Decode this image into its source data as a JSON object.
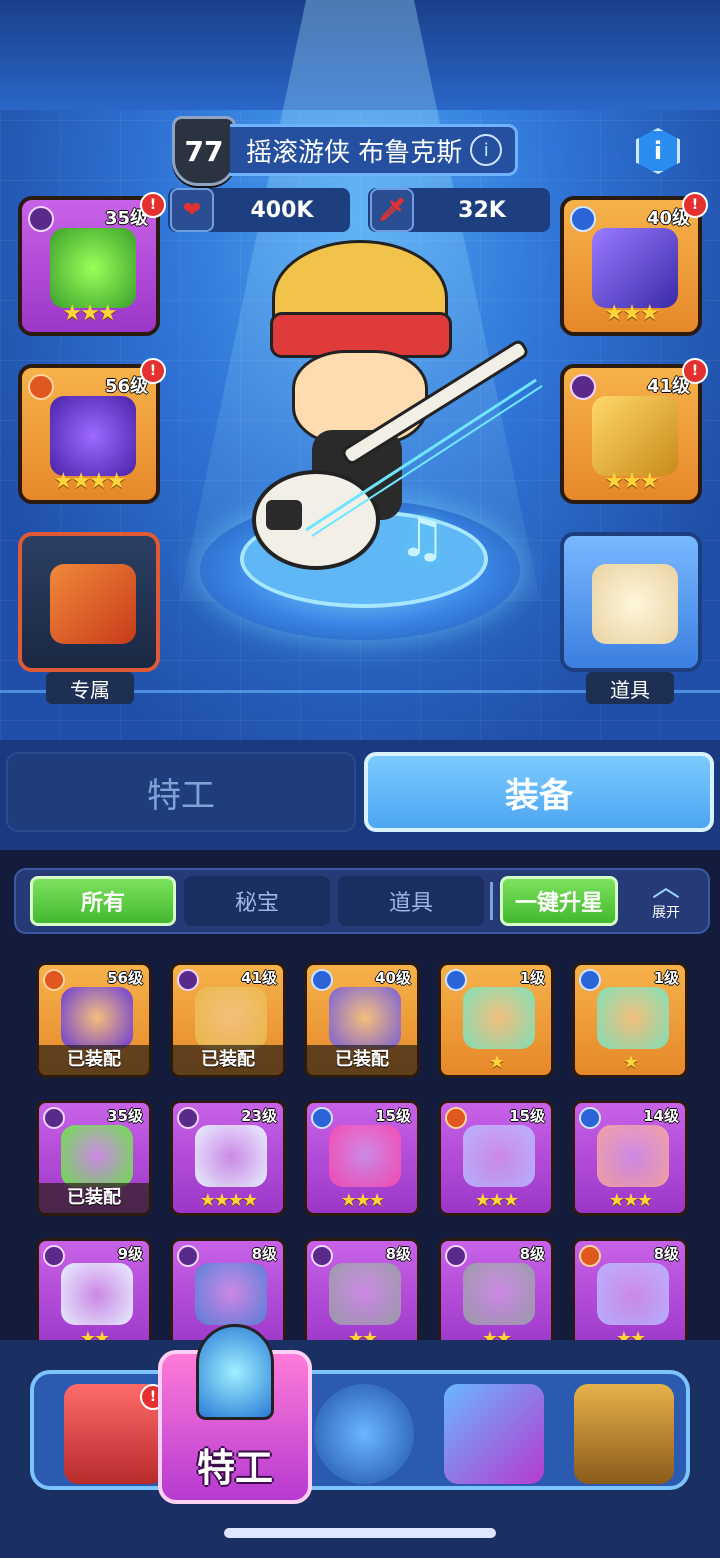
{
  "header": {
    "level": "77",
    "hero_name": "摇滚游侠 布鲁克斯",
    "info_glyph": "i",
    "corner_info_glyph": "i"
  },
  "stats": {
    "hp": "400K",
    "atk": "32K",
    "hp_icon": "heart-icon",
    "atk_icon": "sword-icon"
  },
  "left_slots": [
    {
      "level": "35级",
      "rarity": "gem",
      "stars": "★★★",
      "alert": "!"
    },
    {
      "level": "56级",
      "rarity": "crown",
      "stars": "★★★★",
      "alert": "!"
    },
    {
      "label": "专属"
    }
  ],
  "right_slots": [
    {
      "level": "40级",
      "rarity": "shield",
      "stars": "★★★",
      "alert": "!"
    },
    {
      "level": "41级",
      "rarity": "gem",
      "stars": "★★★",
      "alert": "!"
    },
    {
      "label": "道具"
    }
  ],
  "main_tabs": {
    "agent": "特工",
    "equip": "装备"
  },
  "filters": {
    "all": "所有",
    "treasure": "秘宝",
    "items": "道具",
    "upgrade_all": "一键升星",
    "expand": "展开"
  },
  "inventory": [
    {
      "level": "56级",
      "color": "orange",
      "rarity": "crown",
      "stars": "",
      "equipped": "已装配",
      "art": "#6b3ad6"
    },
    {
      "level": "41级",
      "color": "orange",
      "rarity": "gem",
      "stars": "",
      "equipped": "已装配",
      "art": "#e9b84a"
    },
    {
      "level": "40级",
      "color": "orange",
      "rarity": "shield",
      "stars": "",
      "equipped": "已装配",
      "art": "#7a5fd6"
    },
    {
      "level": "1级",
      "color": "orange",
      "rarity": "shield",
      "stars": "★",
      "equipped": "",
      "art": "#7ee0b8"
    },
    {
      "level": "1级",
      "color": "orange",
      "rarity": "shield",
      "stars": "★",
      "equipped": "",
      "art": "#7ee0b8"
    },
    {
      "level": "35级",
      "color": "purple",
      "rarity": "gem",
      "stars": "",
      "equipped": "已装配",
      "art": "#6be04a"
    },
    {
      "level": "23级",
      "color": "purple",
      "rarity": "gem",
      "stars": "★★★★",
      "equipped": "",
      "art": "#e6f0ff"
    },
    {
      "level": "15级",
      "color": "purple",
      "rarity": "shield",
      "stars": "★★★",
      "equipped": "",
      "art": "#f24ab0"
    },
    {
      "level": "15级",
      "color": "purple",
      "rarity": "crown",
      "stars": "★★★",
      "equipped": "",
      "art": "#b7b0ff"
    },
    {
      "level": "14级",
      "color": "purple",
      "rarity": "shield",
      "stars": "★★★",
      "equipped": "",
      "art": "#f2a0a0"
    },
    {
      "level": "9级",
      "color": "purple",
      "rarity": "gem",
      "stars": "★★",
      "equipped": "",
      "art": "#e6f0ff"
    },
    {
      "level": "8级",
      "color": "purple",
      "rarity": "gem",
      "stars": "",
      "equipped": "",
      "art": "#5a7fd6"
    },
    {
      "level": "8级",
      "color": "purple",
      "rarity": "gem",
      "stars": "★★",
      "equipped": "",
      "art": "#9a9aa8"
    },
    {
      "level": "8级",
      "color": "purple",
      "rarity": "gem",
      "stars": "★★",
      "equipped": "",
      "art": "#9a9aa8"
    },
    {
      "level": "8级",
      "color": "purple",
      "rarity": "crown",
      "stars": "★★",
      "equipped": "",
      "art": "#b7b0ff"
    }
  ],
  "bottom_nav": {
    "active_label": "特工",
    "alert": "!",
    "items": [
      "shop-icon",
      "agent-icon",
      "planet-icon",
      "cube-icon",
      "portal-icon"
    ]
  },
  "colors": {
    "accent": "#4da6f2",
    "active_filter": "#43b830",
    "nav_active": "#b63ad0"
  }
}
